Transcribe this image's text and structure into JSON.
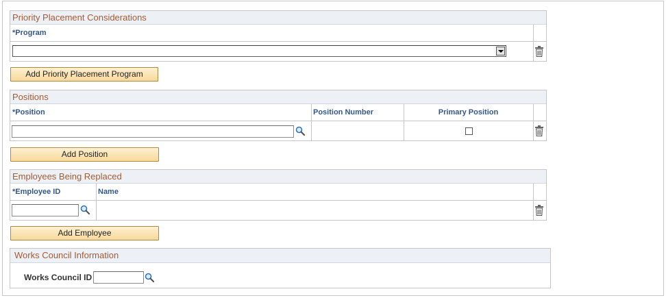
{
  "priority": {
    "title": "Priority Placement Considerations",
    "col_program": "*Program",
    "program_value": "",
    "add_button": "Add Priority Placement Program"
  },
  "positions": {
    "title": "Positions",
    "col_position": "*Position",
    "col_position_number": "Position Number",
    "col_primary": "Primary Position",
    "position_value": "",
    "position_number_value": "",
    "primary_checked": false,
    "add_button": "Add Position"
  },
  "employees": {
    "title": "Employees Being Replaced",
    "col_employee_id": "*Employee ID",
    "col_name": "Name",
    "employee_id_value": "",
    "name_value": "",
    "add_button": "Add Employee"
  },
  "works_council": {
    "title": "Works Council Information",
    "label": "Works Council ID",
    "value": ""
  },
  "icons": {
    "delete": "trash-icon",
    "lookup": "magnifier-icon",
    "dropdown": "chevron-down-icon"
  },
  "colors": {
    "section_title": "#a55a34",
    "column_header": "#32588a",
    "button_top": "#fdf0d2",
    "button_bottom": "#f8d99a"
  }
}
